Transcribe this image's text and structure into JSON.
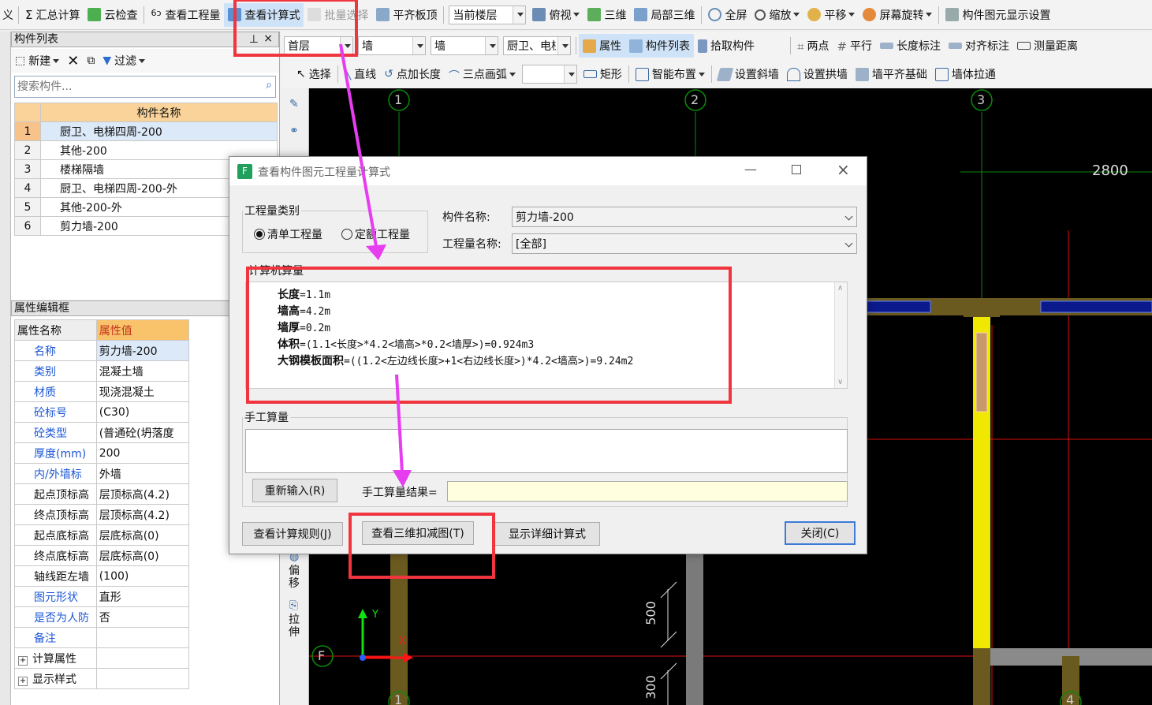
{
  "toolbar1": {
    "cut_left": "义",
    "summary": "汇总计算",
    "cloud_check": "云检查",
    "view_project": "查看工程量",
    "view_formula": "查看计算式",
    "batch_select": "批量选择",
    "align_slab": "平齐板顶",
    "current_floor": "当前楼层",
    "top_view": "俯视",
    "three_d": "三维",
    "local_3d": "局部三维",
    "fullscreen": "全屏",
    "zoom": "缩放",
    "pan": "平移",
    "rotate": "屏幕旋转",
    "display_settings": "构件图元显示设置"
  },
  "toolbar2": {
    "floor": "首层",
    "type1": "墙",
    "type2": "墙",
    "component": "厨卫、电梯",
    "attributes": "属性",
    "component_list": "构件列表",
    "pick": "拾取构件",
    "two_points": "两点",
    "parallel": "平行",
    "length_mark": "长度标注",
    "align_mark": "对齐标注",
    "measure": "测量距离"
  },
  "toolbar3": {
    "select": "选择",
    "line": "直线",
    "point_length": "点加长度",
    "arc": "三点画弧",
    "rect": "矩形",
    "smart": "智能布置",
    "slope": "设置斜墙",
    "arch": "设置拱墙",
    "align_base": "墙平齐基础",
    "extend": "墙体拉通"
  },
  "component_list": {
    "title": "构件列表",
    "new": "新建",
    "filter": "过滤",
    "search_placeholder": "搜索构件...",
    "header": "构件名称",
    "rows": [
      {
        "num": "1",
        "name": "厨卫、电梯四周-200"
      },
      {
        "num": "2",
        "name": "其他-200"
      },
      {
        "num": "3",
        "name": "楼梯隔墙"
      },
      {
        "num": "4",
        "name": "厨卫、电梯四周-200-外"
      },
      {
        "num": "5",
        "name": "其他-200-外"
      },
      {
        "num": "6",
        "name": "剪力墙-200"
      }
    ]
  },
  "property_panel": {
    "title": "属性编辑框",
    "col_name": "属性名称",
    "col_value": "属性值",
    "rows": [
      {
        "name": "名称",
        "value": "剪力墙-200",
        "blue": true
      },
      {
        "name": "类别",
        "value": "混凝土墙",
        "blue": true
      },
      {
        "name": "材质",
        "value": "现浇混凝土",
        "blue": true
      },
      {
        "name": "砼标号",
        "value": "(C30)",
        "blue": true
      },
      {
        "name": "砼类型",
        "value": "(普通砼(坍落度",
        "blue": true
      },
      {
        "name": "厚度(mm)",
        "value": "200",
        "blue": true
      },
      {
        "name": "内/外墙标",
        "value": "外墙",
        "blue": true
      },
      {
        "name": "起点顶标高",
        "value": "层顶标高(4.2)",
        "blue": false
      },
      {
        "name": "终点顶标高",
        "value": "层顶标高(4.2)",
        "blue": false
      },
      {
        "name": "起点底标高",
        "value": "层底标高(0)",
        "blue": false
      },
      {
        "name": "终点底标高",
        "value": "层底标高(0)",
        "blue": false
      },
      {
        "name": "轴线距左墙",
        "value": "(100)",
        "blue": false
      },
      {
        "name": "图元形状",
        "value": "直形",
        "blue": true
      },
      {
        "name": "是否为人防",
        "value": "否",
        "blue": true
      },
      {
        "name": "备注",
        "value": "",
        "blue": true
      },
      {
        "name": "计算属性",
        "value": "",
        "blue": false,
        "expand": "+"
      },
      {
        "name": "显示样式",
        "value": "",
        "blue": false,
        "expand": "+"
      }
    ]
  },
  "side_tools": {
    "offset": "偏移",
    "stretch": "拉伸"
  },
  "canvas": {
    "axes": [
      "1",
      "2",
      "3",
      "F",
      "1",
      "4"
    ],
    "dim_top": "2800",
    "dim_500": "500",
    "dim_300": "300",
    "axis_x": "X",
    "axis_y": "Y"
  },
  "dialog": {
    "title": "查看构件图元工程量计算式",
    "group_type": "工程量类别",
    "radio_list": "清单工程量",
    "radio_quota": "定额工程量",
    "comp_name_label": "构件名称:",
    "comp_name_value": "剪力墙-200",
    "qty_name_label": "工程量名称:",
    "qty_name_value": "[全部]",
    "machine_calc_label": "计算机算量",
    "formula_lines": [
      {
        "key": "长度",
        "rest": "=1.1m"
      },
      {
        "key": "墙高",
        "rest": "=4.2m"
      },
      {
        "key": "墙厚",
        "rest": "=0.2m"
      },
      {
        "key": "体积",
        "rest": "=(1.1<长度>*4.2<墙高>*0.2<墙厚>)=0.924m3"
      },
      {
        "key": "大钢模板面积",
        "rest": "=((1.2<左边线长度>+1<右边线长度>)*4.2<墙高>)=9.24m2"
      }
    ],
    "manual_label": "手工算量",
    "reenter": "重新输入(R)",
    "manual_result": "手工算量结果=",
    "view_rules": "查看计算规则(J)",
    "view_3d": "查看三维扣减图(T)",
    "show_detail": "显示详细计算式",
    "close": "关闭(C)"
  },
  "colors": {
    "highlight": "#f0353e",
    "arrow": "#e63df0",
    "canvas": "#000000"
  }
}
